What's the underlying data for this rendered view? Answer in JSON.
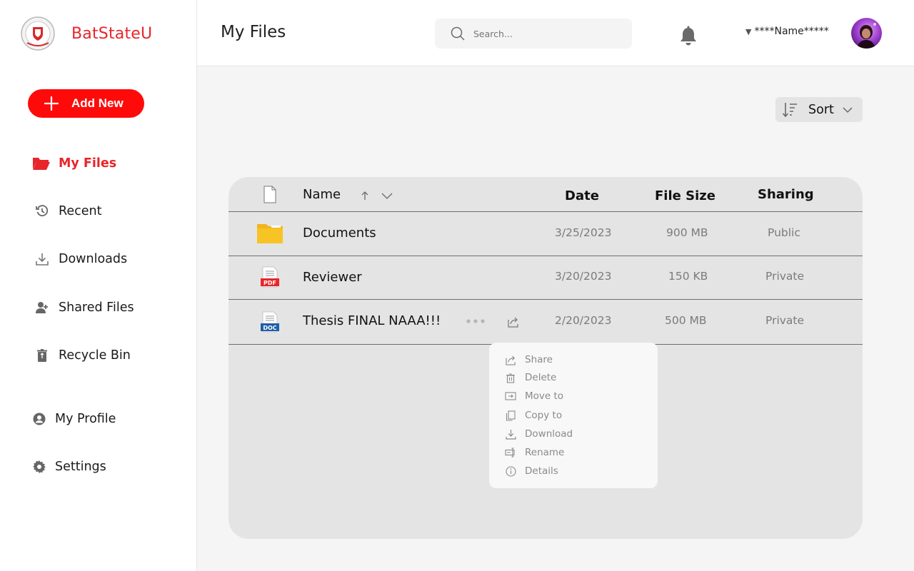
{
  "brand": {
    "name": "BatStateU"
  },
  "sidebar": {
    "add_new": "Add New",
    "items": [
      {
        "label": "My Files",
        "icon": "folder-open-icon",
        "active": true
      },
      {
        "label": "Recent",
        "icon": "history-icon"
      },
      {
        "label": "Downloads",
        "icon": "download-icon"
      },
      {
        "label": "Shared Files",
        "icon": "shared-user-icon"
      },
      {
        "label": "Recycle Bin",
        "icon": "trash-icon"
      },
      {
        "label": "My Profile",
        "icon": "profile-icon"
      },
      {
        "label": "Settings",
        "icon": "gear-icon"
      }
    ]
  },
  "header": {
    "title": "My Files",
    "search_placeholder": "Search...",
    "user_name": "****Name*****"
  },
  "sort": {
    "label": "Sort"
  },
  "table": {
    "columns": {
      "name": "Name",
      "date": "Date",
      "size": "File Size",
      "sharing": "Sharing"
    },
    "rows": [
      {
        "name": "Documents",
        "type": "folder",
        "date": "3/25/2023",
        "size": "900 MB",
        "sharing": "Public"
      },
      {
        "name": "Reviewer",
        "type": "pdf",
        "type_label": "PDF",
        "date": "3/20/2023",
        "size": "150 KB",
        "sharing": "Private"
      },
      {
        "name": "Thesis FINAL NAAA!!!",
        "type": "doc",
        "type_label": "DOC",
        "date": "2/20/2023",
        "size": "500 MB",
        "sharing": "Private"
      }
    ]
  },
  "context_menu": {
    "items": [
      {
        "label": "Share",
        "icon": "share-icon"
      },
      {
        "label": "Delete",
        "icon": "trash-icon"
      },
      {
        "label": "Move to",
        "icon": "move-icon"
      },
      {
        "label": "Copy to",
        "icon": "copy-icon"
      },
      {
        "label": "Download",
        "icon": "download-icon"
      },
      {
        "label": "Rename",
        "icon": "rename-icon"
      },
      {
        "label": "Details",
        "icon": "info-icon"
      }
    ]
  },
  "colors": {
    "accent": "#e8252b",
    "button": "#ff0a0a",
    "folder": "#f7c325",
    "pdf": "#e8252b",
    "doc": "#1f5fa8"
  }
}
